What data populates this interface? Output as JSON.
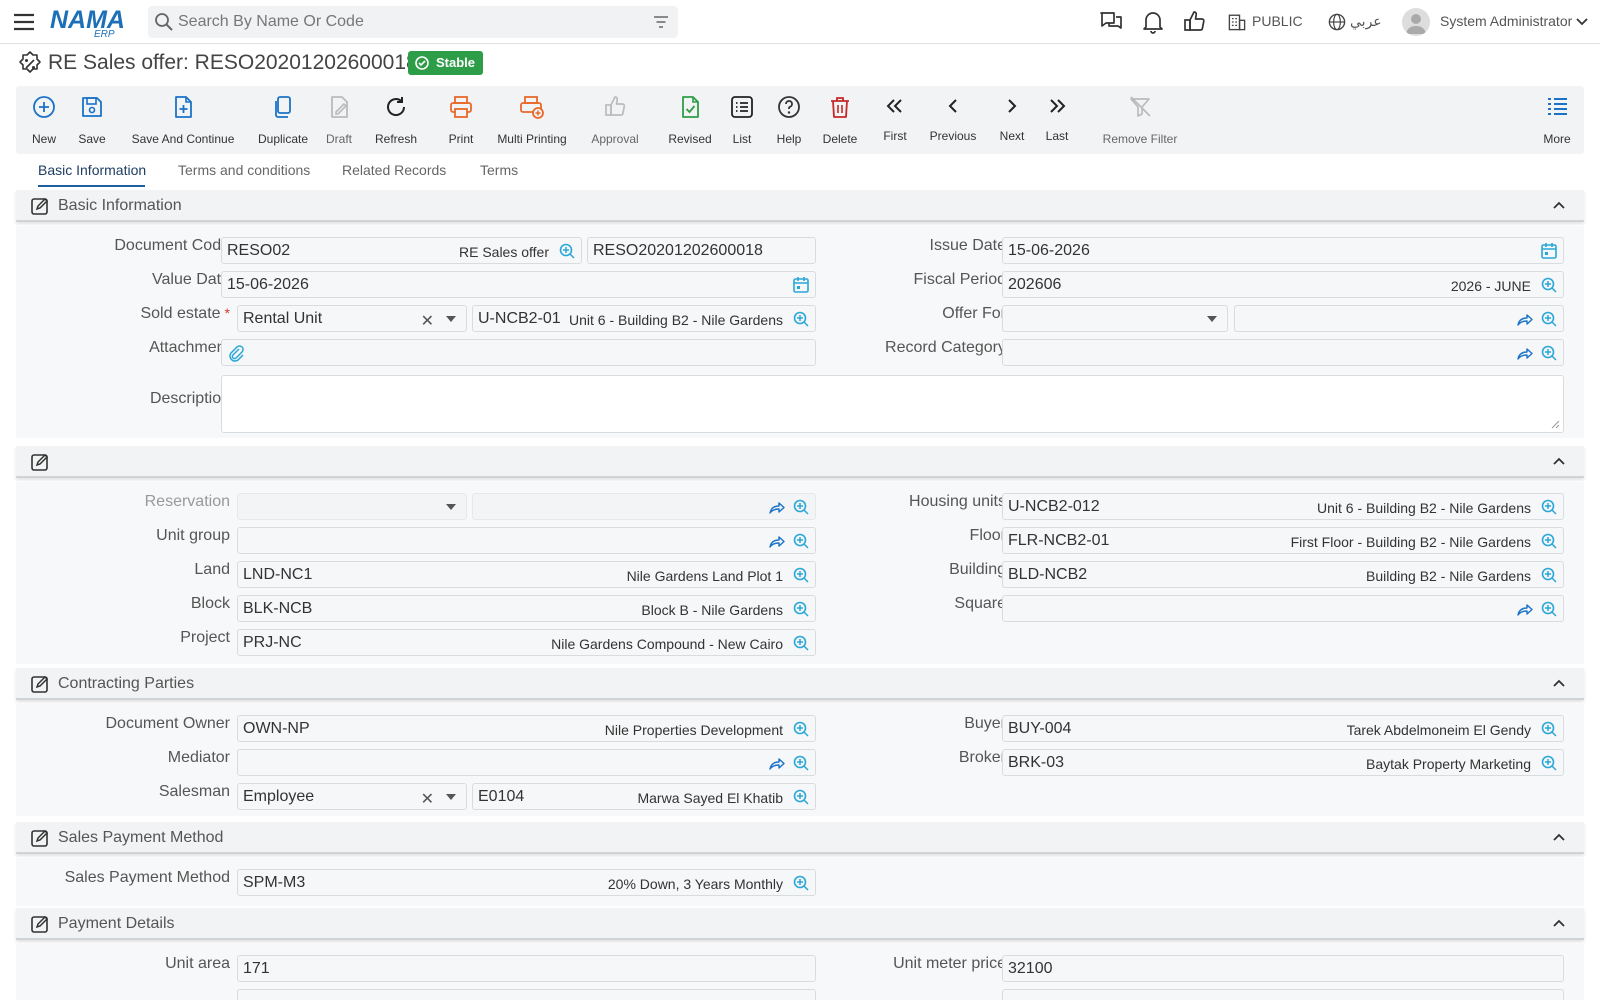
{
  "header": {
    "logo_text": "NAMA",
    "logo_sub": "ERP",
    "search_placeholder": "Search By Name Or Code",
    "branch": "PUBLIC",
    "language": "عربي",
    "user": "System Administrator"
  },
  "page": {
    "title": "RE Sales offer: RESO20201202600018",
    "status": "Stable"
  },
  "toolbar": {
    "new": "New",
    "save": "Save",
    "save_continue": "Save And Continue",
    "duplicate": "Duplicate",
    "draft": "Draft",
    "refresh": "Refresh",
    "print": "Print",
    "multi_print": "Multi Printing",
    "approval": "Approval",
    "revised": "Revised",
    "list": "List",
    "help": "Help",
    "delete": "Delete",
    "first": "First",
    "previous": "Previous",
    "next": "Next",
    "last": "Last",
    "remove_filter": "Remove Filter",
    "more": "More"
  },
  "tabs": [
    "Basic Information",
    "Terms and conditions",
    "Related Records",
    "Terms"
  ],
  "basic": {
    "title": "Basic Information",
    "doc_code_label": "Document Code",
    "doc_code": "RESO02",
    "doc_code_desc": "RE Sales offer",
    "doc_number": "RESO20201202600018",
    "issue_date_label": "Issue Date",
    "issue_date": "15-06-2026",
    "value_date_label": "Value Date",
    "value_date": "15-06-2026",
    "fiscal_period_label": "Fiscal Period",
    "fiscal_period": "202606",
    "fiscal_period_desc": "2026 - JUNE",
    "sold_estate_label": "Sold estate",
    "sold_estate_type": "Rental Unit",
    "sold_estate_code": "U-NCB2-01",
    "sold_estate_desc": "Unit 6 - Building B2 - Nile Gardens",
    "offer_for_label": "Offer For",
    "attachment_label": "Attachment",
    "record_category_label": "Record Category",
    "description_label": "Description",
    "required_mark": "*"
  },
  "unit": {
    "reservation_label": "Reservation",
    "housing_units_label": "Housing units",
    "housing_units": "U-NCB2-012",
    "housing_units_desc": "Unit 6 - Building B2 - Nile Gardens",
    "unit_group_label": "Unit group",
    "floor_label": "Floor",
    "floor": "FLR-NCB2-01",
    "floor_desc": "First Floor - Building B2 - Nile Gardens",
    "land_label": "Land",
    "land": "LND-NC1",
    "land_desc": "Nile Gardens Land Plot 1",
    "building_label": "Building",
    "building": "BLD-NCB2",
    "building_desc": "Building B2 - Nile Gardens",
    "block_label": "Block",
    "block": "BLK-NCB",
    "block_desc": "Block B - Nile Gardens",
    "square_label": "Square",
    "project_label": "Project",
    "project": "PRJ-NC",
    "project_desc": "Nile Gardens Compound - New Cairo"
  },
  "parties": {
    "title": "Contracting Parties",
    "owner_label": "Document Owner",
    "owner": "OWN-NP",
    "owner_desc": "Nile Properties Development",
    "buyer_label": "Buyer",
    "buyer": "BUY-004",
    "buyer_desc": "Tarek Abdelmoneim El Gendy",
    "mediator_label": "Mediator",
    "broker_label": "Broker",
    "broker": "BRK-03",
    "broker_desc": "Baytak Property Marketing",
    "salesman_label": "Salesman",
    "salesman_type": "Employee",
    "salesman_code": "E0104",
    "salesman_desc": "Marwa Sayed El Khatib"
  },
  "payment_method": {
    "title": "Sales Payment Method",
    "label": "Sales Payment Method",
    "code": "SPM-M3",
    "desc": "20% Down, 3 Years Monthly"
  },
  "payment_details": {
    "title": "Payment Details",
    "unit_area_label": "Unit area",
    "unit_area": "171",
    "unit_meter_price_label": "Unit meter price",
    "unit_meter_price": "32100"
  }
}
